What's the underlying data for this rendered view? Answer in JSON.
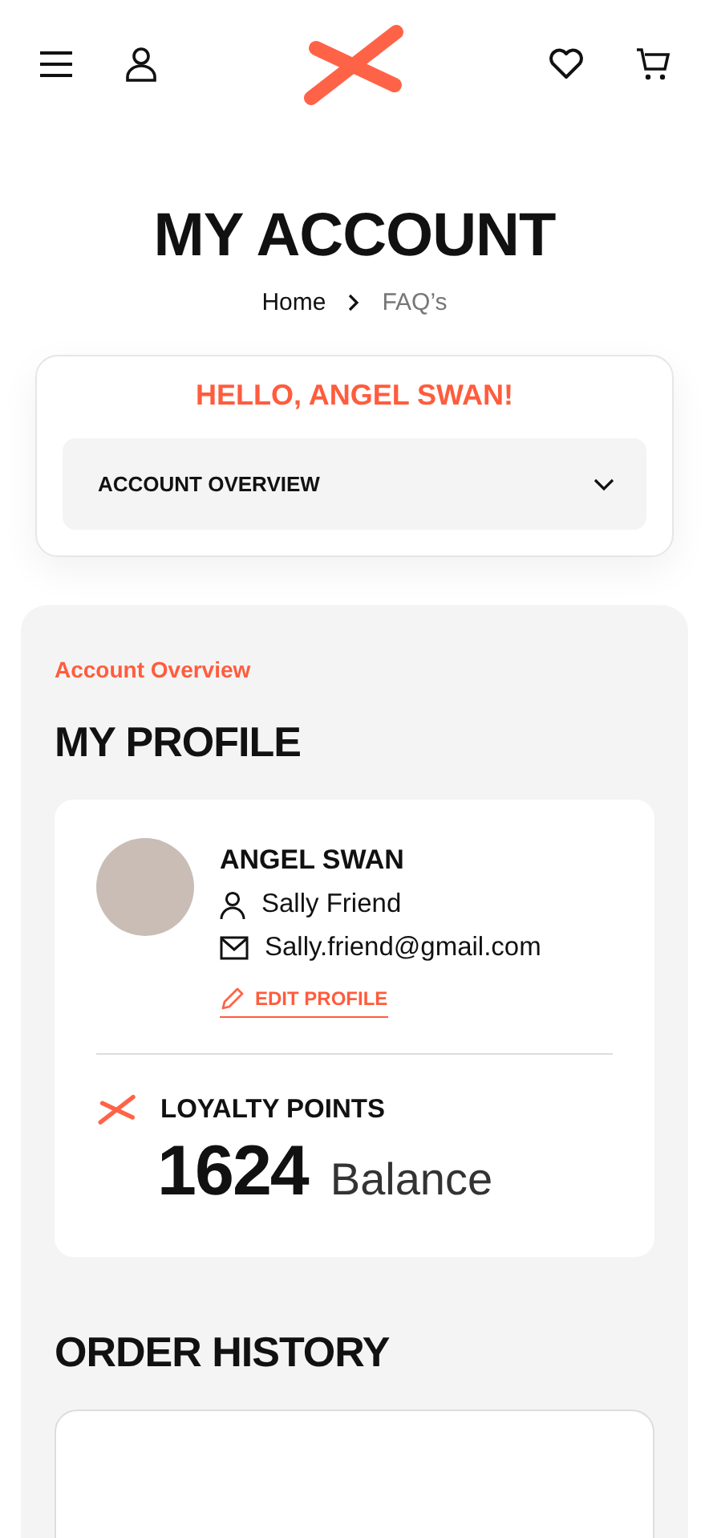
{
  "title": "MY ACCOUNT",
  "breadcrumb": [
    {
      "label": "Home",
      "selected": false
    },
    {
      "label": "FAQ’s",
      "selected": true
    }
  ],
  "greeting": "HELLO, ANGEL SWAN!",
  "section_menu": {
    "label": "ACCOUNT OVERVIEW",
    "expanded": false
  },
  "overview": {
    "eyebrow": "Account Overview",
    "heading": "MY PROFILE",
    "profile": {
      "name": "ANGEL SWAN",
      "username": "Sally Friend",
      "email": "Sally.friend@gmail.com",
      "edit_link": "EDIT PROFILE"
    },
    "loyalty": {
      "label": "LOYALTY POINTS",
      "points": "1624",
      "points_caption": "Balance"
    },
    "order_history": {
      "heading": "ORDER HISTORY"
    }
  }
}
